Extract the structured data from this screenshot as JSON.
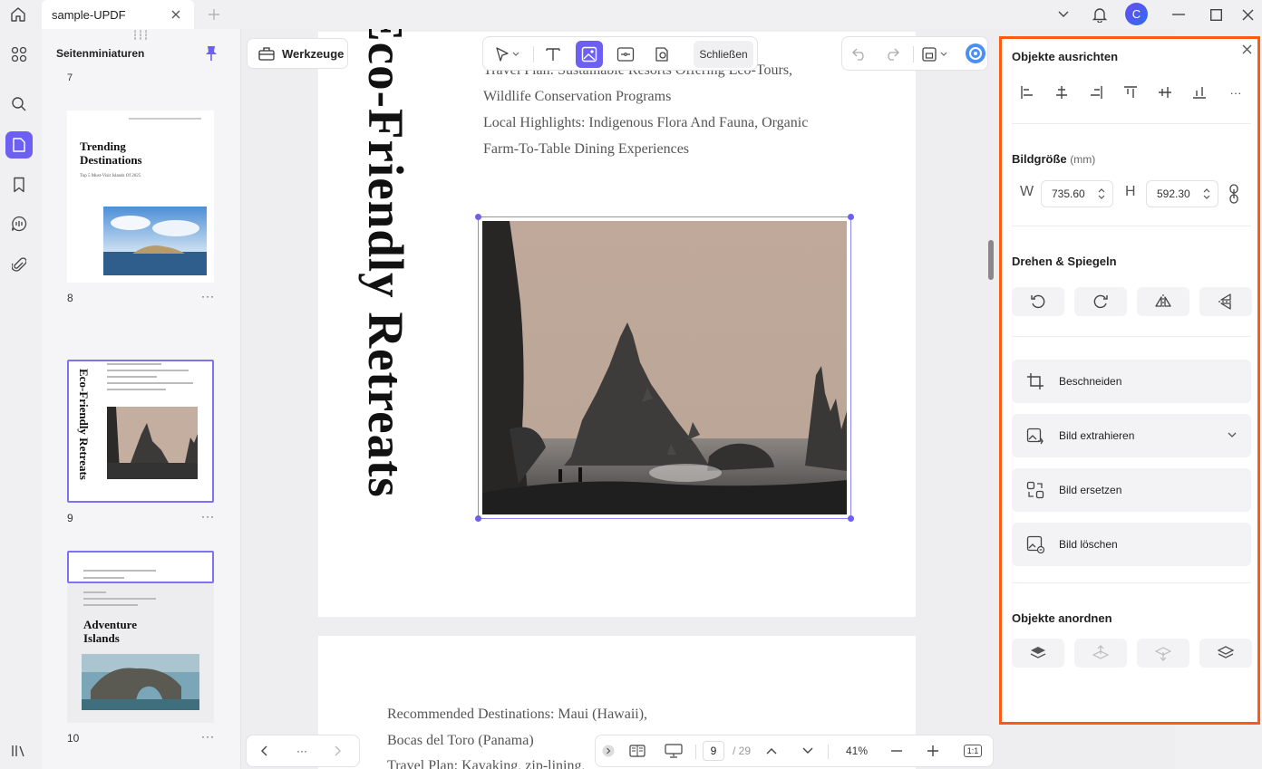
{
  "tab": {
    "title": "sample-UPDF"
  },
  "user": {
    "initial": "C"
  },
  "thumbnails": {
    "title": "Seitenminiaturen",
    "top_page_partial": "7",
    "pages": [
      {
        "number": "8",
        "heading_line1": "Trending",
        "heading_line2": "Destinations",
        "subtitle": "Top 5 Must-Visit Islands Of 2025"
      },
      {
        "number": "9",
        "heading": "Eco-Friendly Retreats"
      },
      {
        "number": "10",
        "heading_line1": "Adventure",
        "heading_line2": "Islands"
      }
    ],
    "more": "···"
  },
  "toolbar": {
    "tools_label": "Werkzeuge",
    "close_label": "Schließen"
  },
  "page9": {
    "vertical_title": "Eco-Friendly Retreats",
    "lines": [
      "Travel Plan: Sustainable Resorts Offering Eco-Tours,",
      "Wildlife Conservation Programs",
      "Local Highlights: Indigenous Flora And Fauna, Organic",
      "Farm-To-Table Dining Experiences"
    ]
  },
  "page10": {
    "lines": [
      "Recommended Destinations: Maui (Hawaii),",
      "Bocas del Toro (Panama)",
      "Travel Plan: Kayaking, zip-lining,"
    ]
  },
  "navigation": {
    "more": "···",
    "current_page": "9",
    "total_pages": "/ 29",
    "zoom": "41%",
    "fit": "1:1"
  },
  "properties": {
    "align_title": "Objekte ausrichten",
    "size_title": "Bildgröße",
    "size_unit": "(mm)",
    "width_label": "W",
    "width_value": "735.60",
    "height_label": "H",
    "height_value": "592.30",
    "rotate_title": "Drehen & Spiegeln",
    "actions": {
      "crop": "Beschneiden",
      "extract": "Bild extrahieren",
      "replace": "Bild ersetzen",
      "delete": "Bild löschen"
    },
    "arrange_title": "Objekte anordnen",
    "more": "···"
  },
  "colors": {
    "accent": "#6c5ff2",
    "highlight_border": "#ff5a14"
  }
}
